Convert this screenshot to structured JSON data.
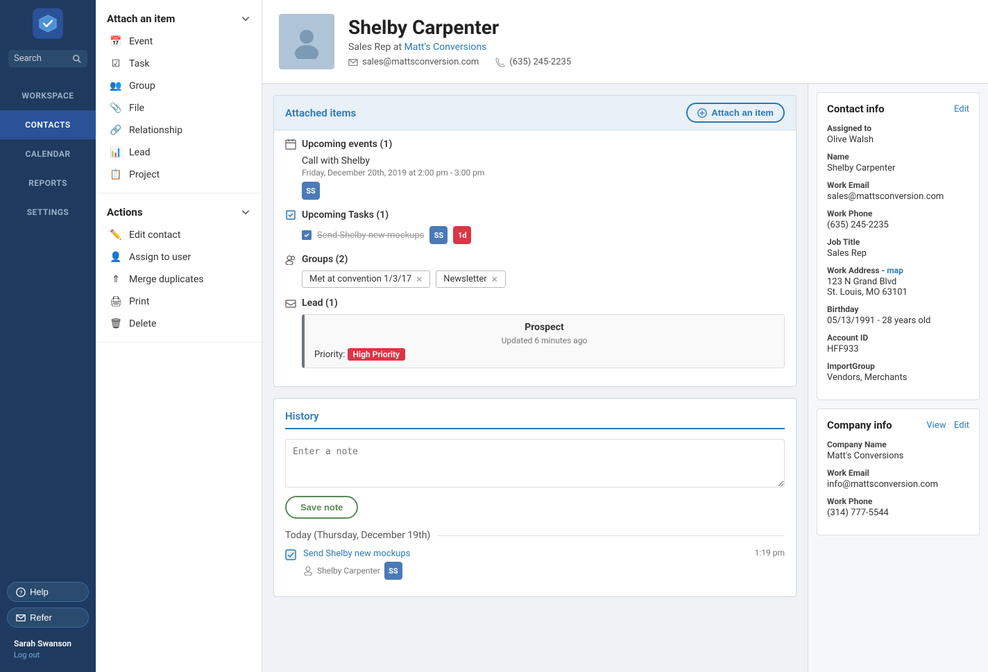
{
  "sidebar": {
    "logo_label": "Logo",
    "search_placeholder": "Search",
    "nav_items": [
      {
        "id": "workspace",
        "label": "WORKSPACE",
        "active": false
      },
      {
        "id": "contacts",
        "label": "CONTACTS",
        "active": true
      },
      {
        "id": "calendar",
        "label": "CALENDAR",
        "active": false
      },
      {
        "id": "reports",
        "label": "REPORTS",
        "active": false
      },
      {
        "id": "settings",
        "label": "SETTINGS",
        "active": false
      }
    ],
    "help_label": "Help",
    "refer_label": "Refer",
    "user_name": "Sarah Swanson",
    "logout_label": "Log out"
  },
  "actions_panel": {
    "attach_header": "Attach an item",
    "attach_items": [
      {
        "id": "event",
        "label": "Event"
      },
      {
        "id": "task",
        "label": "Task"
      },
      {
        "id": "group",
        "label": "Group"
      },
      {
        "id": "file",
        "label": "File"
      },
      {
        "id": "relationship",
        "label": "Relationship"
      },
      {
        "id": "lead",
        "label": "Lead"
      },
      {
        "id": "project",
        "label": "Project"
      }
    ],
    "actions_header": "Actions",
    "action_items": [
      {
        "id": "edit-contact",
        "label": "Edit contact"
      },
      {
        "id": "assign-to-user",
        "label": "Assign to user"
      },
      {
        "id": "merge-duplicates",
        "label": "Merge duplicates"
      },
      {
        "id": "print",
        "label": "Print"
      },
      {
        "id": "delete",
        "label": "Delete"
      }
    ]
  },
  "profile": {
    "name": "Shelby Carpenter",
    "title": "Sales Rep",
    "company": "Matt's Conversions",
    "email": "sales@mattsconversion.com",
    "phone": "(635) 245-2235"
  },
  "attached_items": {
    "title": "Attached items",
    "attach_btn_label": "Attach an item",
    "upcoming_events": {
      "title": "Upcoming events (1)",
      "event_name": "Call with Shelby",
      "event_date": "Friday, December 20th, 2019 at 2:00 pm - 3:00 pm",
      "badge": "SS"
    },
    "upcoming_tasks": {
      "title": "Upcoming Tasks (1)",
      "task_name": "Send Shelby new mockups",
      "badge1": "SS",
      "badge2": "1d"
    },
    "groups": {
      "title": "Groups (2)",
      "tags": [
        "Met at convention 1/3/17",
        "Newsletter"
      ]
    },
    "lead": {
      "title": "Lead (1)",
      "status": "Prospect",
      "updated": "Updated 6 minutes ago",
      "priority_label": "Priority:",
      "priority_value": "High Priority"
    }
  },
  "history": {
    "title": "History",
    "note_placeholder": "Enter a note",
    "save_note_label": "Save note",
    "today_label": "Today (Thursday, December 19th)",
    "history_items": [
      {
        "id": "h1",
        "task": "Send Shelby new mockups",
        "time": "1:19 pm",
        "person": "Shelby Carpenter",
        "badge": "SS"
      }
    ]
  },
  "contact_info": {
    "title": "Contact info",
    "edit_label": "Edit",
    "fields": [
      {
        "label": "Assigned to",
        "value": "Olive Walsh"
      },
      {
        "label": "Name",
        "value": "Shelby Carpenter"
      },
      {
        "label": "Work Email",
        "value": "sales@mattsconversion.com"
      },
      {
        "label": "Work Phone",
        "value": "(635) 245-2235"
      },
      {
        "label": "Job Title",
        "value": "Sales Rep"
      },
      {
        "label": "Work Address",
        "value": "123 N Grand Blvd\nSt. Louis, MO 63101",
        "has_map": true
      },
      {
        "label": "Birthday",
        "value": "05/13/1991 - 28 years old"
      },
      {
        "label": "Account ID",
        "value": "HFF933"
      },
      {
        "label": "ImportGroup",
        "value": "Vendors, Merchants"
      }
    ]
  },
  "company_info": {
    "title": "Company info",
    "view_label": "View",
    "edit_label": "Edit",
    "fields": [
      {
        "label": "Company Name",
        "value": "Matt's Conversions"
      },
      {
        "label": "Work Email",
        "value": "info@mattsconversion.com"
      },
      {
        "label": "Work Phone",
        "value": "(314) 777-5544"
      }
    ]
  }
}
